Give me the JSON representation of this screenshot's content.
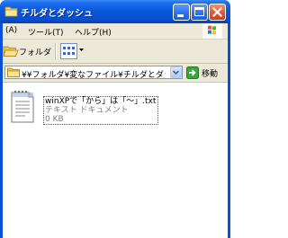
{
  "window": {
    "title": "チルダとダッシュ"
  },
  "menu": {
    "items": [
      {
        "label": "(A)"
      },
      {
        "label": "ツール(T)"
      },
      {
        "label": "ヘルプ(H)"
      }
    ]
  },
  "toolbar": {
    "folder_label": "フォルダ",
    "views_icon": "views-icon"
  },
  "address": {
    "path": "¥¥フォルダ¥変なファイル¥チルダとダッシュ",
    "go_label": "移動"
  },
  "files": [
    {
      "name": "winXPで「から」は「〜」.txt",
      "type": "テキスト ドキュメント",
      "size": "0 KB",
      "icon": "text-document-icon"
    }
  ],
  "colors": {
    "titlebar": "#0a58dc",
    "chrome": "#ece9d8",
    "close_button": "#e0563a",
    "go_arrow": "#2c9a2c"
  }
}
